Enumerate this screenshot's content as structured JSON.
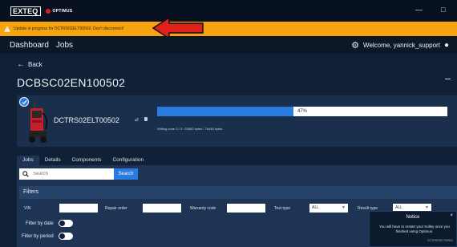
{
  "titlebar": {
    "brand": "EXTEQ",
    "product": "OPTIMUS",
    "minimize_glyph": "—",
    "maximize_glyph": "□"
  },
  "banner": {
    "message": "Update in progress for DCTRS02ELT00502. Don't disconnect!",
    "background": "#f5a30e",
    "arrow_color": "#e0201c"
  },
  "nav": {
    "links": [
      "Dashboard",
      "Jobs"
    ],
    "welcome": "Welcome, yannick_support"
  },
  "page": {
    "back_label": "Back",
    "title": "DCBSC02EN100502"
  },
  "device": {
    "name": "DCTRS02ELT00502",
    "progress_percent": 47,
    "progress_label": "47%",
    "progress_detail": "Writing zone 3 / 3 : 53600 bytes / 76448 bytes",
    "accent": "#2a7be1"
  },
  "tabs": [
    "Jobs",
    "Details",
    "Components",
    "Configuration"
  ],
  "search": {
    "placeholder": "Search",
    "button_label": "Search"
  },
  "filters": {
    "heading": "Filters",
    "vin_label": "VIN",
    "repair_order_label": "Repair order",
    "warranty_code_label": "Warranty code",
    "test_type_label": "Test type",
    "test_type_value": "ALL",
    "result_type_label": "Result type",
    "result_type_value": "ALL",
    "filter_by_date_label": "Filter by date",
    "filter_by_period_label": "Filter by period"
  },
  "notice": {
    "title": "Notice",
    "body": "You will have to restart your trolley once you finished using Optimus.",
    "id": "DCTRS02ELT00502",
    "close": "×"
  }
}
